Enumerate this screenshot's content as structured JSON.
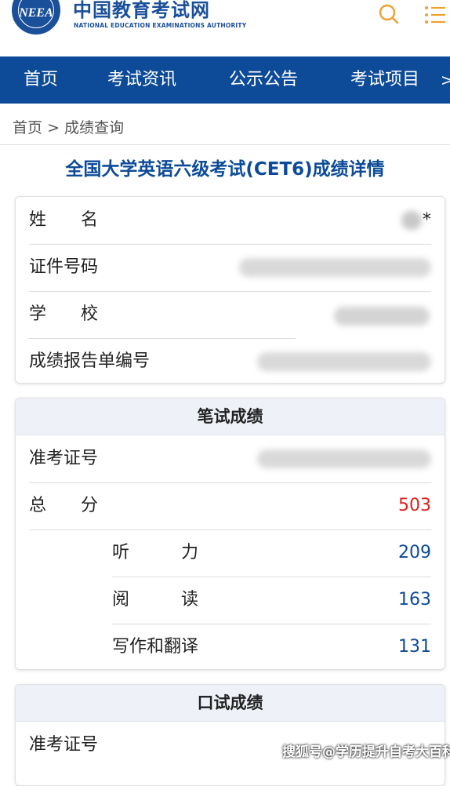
{
  "header": {
    "logo_seal_text": "NEEA",
    "logo_cn": "中国教育考试网",
    "logo_en": "NATIONAL EDUCATION EXAMINATIONS AUTHORITY",
    "icons": {
      "search": "search-icon",
      "menu": "menu-icon"
    },
    "brand_color": "#1a4f9a",
    "accent_color": "#f0a030"
  },
  "nav": {
    "items": [
      "首页",
      "考试资讯",
      "公示公告",
      "考试项目"
    ],
    "more": ">",
    "background": "#0d4b98"
  },
  "breadcrumb": {
    "home": "首页",
    "sep": ">",
    "current": "成绩查询"
  },
  "page_title": "全国大学英语六级考试(CET6)成绩详情",
  "personal": {
    "name_label": "姓　　名",
    "name_value": "*",
    "id_label": "证件号码",
    "school_label": "学　　校",
    "report_label": "成绩报告单编号"
  },
  "written": {
    "title": "笔试成绩",
    "ticket_label": "准考证号",
    "total_label": "总　　分",
    "total_value": "503",
    "listening_label": "听　　　力",
    "listening_value": "209",
    "reading_label": "阅　　　读",
    "reading_value": "163",
    "writing_label": "写作和翻译",
    "writing_value": "131"
  },
  "oral": {
    "title": "口试成绩",
    "ticket_label": "准考证号"
  },
  "colors": {
    "score_red": "#e02020",
    "score_blue": "#0d4b98"
  },
  "watermark": "搜狐号@学历提升自考大百科"
}
